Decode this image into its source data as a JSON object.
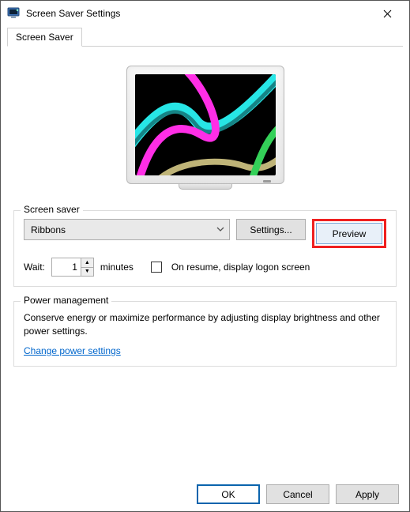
{
  "window": {
    "title": "Screen Saver Settings"
  },
  "tabs": [
    {
      "label": "Screen Saver"
    }
  ],
  "saver": {
    "group_title": "Screen saver",
    "selected": "Ribbons",
    "settings_label": "Settings...",
    "preview_label": "Preview",
    "wait_label": "Wait:",
    "wait_value": "1",
    "minutes_label": "minutes",
    "onresume_label": "On resume, display logon screen"
  },
  "power": {
    "group_title": "Power management",
    "description": "Conserve energy or maximize performance by adjusting display brightness and other power settings.",
    "link_label": "Change power settings"
  },
  "footer": {
    "ok": "OK",
    "cancel": "Cancel",
    "apply": "Apply"
  }
}
